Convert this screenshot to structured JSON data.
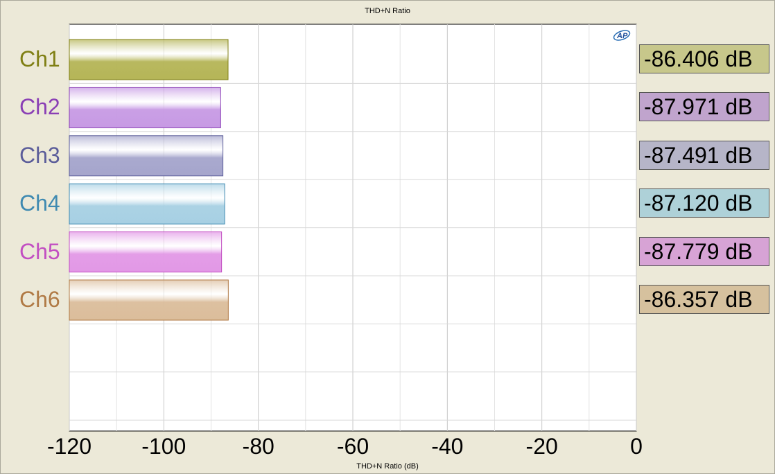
{
  "chart_data": {
    "type": "bar",
    "orientation": "horizontal",
    "title": "THD+N Ratio",
    "xlabel": "THD+N Ratio (dB)",
    "xlim": [
      -120,
      0
    ],
    "x_ticks": [
      "-120",
      "-100",
      "-80",
      "-60",
      "-40",
      "-20",
      "0"
    ],
    "grid": true,
    "categories": [
      "Ch1",
      "Ch2",
      "Ch3",
      "Ch4",
      "Ch5",
      "Ch6"
    ],
    "values": [
      -86.406,
      -87.971,
      -87.491,
      -87.12,
      -87.779,
      -86.357
    ],
    "readouts": [
      "-86.406 dB",
      "-87.971 dB",
      "-87.491 dB",
      "-87.120 dB",
      "-87.779 dB",
      "-86.357 dB"
    ],
    "label_colors": [
      "#7f7f14",
      "#8a3fb5",
      "#5b5d9a",
      "#3f8ab1",
      "#c24fc2",
      "#b07a45"
    ],
    "bar_colors": [
      "#b5b557",
      "#c79ae4",
      "#a5a5cc",
      "#a7d0e3",
      "#e298e6",
      "#dbbd9b"
    ],
    "readout_colors": [
      "#c7c78b",
      "#c0a4cd",
      "#b6b5c8",
      "#aed1d8",
      "#d7a3d5",
      "#d6c19e"
    ]
  },
  "logo": "AP"
}
